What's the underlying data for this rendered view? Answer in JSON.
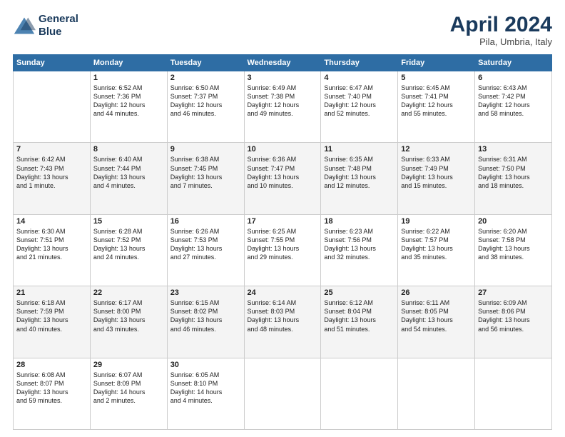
{
  "header": {
    "logo_line1": "General",
    "logo_line2": "Blue",
    "month_year": "April 2024",
    "location": "Pila, Umbria, Italy"
  },
  "weekdays": [
    "Sunday",
    "Monday",
    "Tuesday",
    "Wednesday",
    "Thursday",
    "Friday",
    "Saturday"
  ],
  "weeks": [
    [
      {
        "day": "",
        "text": ""
      },
      {
        "day": "1",
        "text": "Sunrise: 6:52 AM\nSunset: 7:36 PM\nDaylight: 12 hours\nand 44 minutes."
      },
      {
        "day": "2",
        "text": "Sunrise: 6:50 AM\nSunset: 7:37 PM\nDaylight: 12 hours\nand 46 minutes."
      },
      {
        "day": "3",
        "text": "Sunrise: 6:49 AM\nSunset: 7:38 PM\nDaylight: 12 hours\nand 49 minutes."
      },
      {
        "day": "4",
        "text": "Sunrise: 6:47 AM\nSunset: 7:40 PM\nDaylight: 12 hours\nand 52 minutes."
      },
      {
        "day": "5",
        "text": "Sunrise: 6:45 AM\nSunset: 7:41 PM\nDaylight: 12 hours\nand 55 minutes."
      },
      {
        "day": "6",
        "text": "Sunrise: 6:43 AM\nSunset: 7:42 PM\nDaylight: 12 hours\nand 58 minutes."
      }
    ],
    [
      {
        "day": "7",
        "text": "Sunrise: 6:42 AM\nSunset: 7:43 PM\nDaylight: 13 hours\nand 1 minute."
      },
      {
        "day": "8",
        "text": "Sunrise: 6:40 AM\nSunset: 7:44 PM\nDaylight: 13 hours\nand 4 minutes."
      },
      {
        "day": "9",
        "text": "Sunrise: 6:38 AM\nSunset: 7:45 PM\nDaylight: 13 hours\nand 7 minutes."
      },
      {
        "day": "10",
        "text": "Sunrise: 6:36 AM\nSunset: 7:47 PM\nDaylight: 13 hours\nand 10 minutes."
      },
      {
        "day": "11",
        "text": "Sunrise: 6:35 AM\nSunset: 7:48 PM\nDaylight: 13 hours\nand 12 minutes."
      },
      {
        "day": "12",
        "text": "Sunrise: 6:33 AM\nSunset: 7:49 PM\nDaylight: 13 hours\nand 15 minutes."
      },
      {
        "day": "13",
        "text": "Sunrise: 6:31 AM\nSunset: 7:50 PM\nDaylight: 13 hours\nand 18 minutes."
      }
    ],
    [
      {
        "day": "14",
        "text": "Sunrise: 6:30 AM\nSunset: 7:51 PM\nDaylight: 13 hours\nand 21 minutes."
      },
      {
        "day": "15",
        "text": "Sunrise: 6:28 AM\nSunset: 7:52 PM\nDaylight: 13 hours\nand 24 minutes."
      },
      {
        "day": "16",
        "text": "Sunrise: 6:26 AM\nSunset: 7:53 PM\nDaylight: 13 hours\nand 27 minutes."
      },
      {
        "day": "17",
        "text": "Sunrise: 6:25 AM\nSunset: 7:55 PM\nDaylight: 13 hours\nand 29 minutes."
      },
      {
        "day": "18",
        "text": "Sunrise: 6:23 AM\nSunset: 7:56 PM\nDaylight: 13 hours\nand 32 minutes."
      },
      {
        "day": "19",
        "text": "Sunrise: 6:22 AM\nSunset: 7:57 PM\nDaylight: 13 hours\nand 35 minutes."
      },
      {
        "day": "20",
        "text": "Sunrise: 6:20 AM\nSunset: 7:58 PM\nDaylight: 13 hours\nand 38 minutes."
      }
    ],
    [
      {
        "day": "21",
        "text": "Sunrise: 6:18 AM\nSunset: 7:59 PM\nDaylight: 13 hours\nand 40 minutes."
      },
      {
        "day": "22",
        "text": "Sunrise: 6:17 AM\nSunset: 8:00 PM\nDaylight: 13 hours\nand 43 minutes."
      },
      {
        "day": "23",
        "text": "Sunrise: 6:15 AM\nSunset: 8:02 PM\nDaylight: 13 hours\nand 46 minutes."
      },
      {
        "day": "24",
        "text": "Sunrise: 6:14 AM\nSunset: 8:03 PM\nDaylight: 13 hours\nand 48 minutes."
      },
      {
        "day": "25",
        "text": "Sunrise: 6:12 AM\nSunset: 8:04 PM\nDaylight: 13 hours\nand 51 minutes."
      },
      {
        "day": "26",
        "text": "Sunrise: 6:11 AM\nSunset: 8:05 PM\nDaylight: 13 hours\nand 54 minutes."
      },
      {
        "day": "27",
        "text": "Sunrise: 6:09 AM\nSunset: 8:06 PM\nDaylight: 13 hours\nand 56 minutes."
      }
    ],
    [
      {
        "day": "28",
        "text": "Sunrise: 6:08 AM\nSunset: 8:07 PM\nDaylight: 13 hours\nand 59 minutes."
      },
      {
        "day": "29",
        "text": "Sunrise: 6:07 AM\nSunset: 8:09 PM\nDaylight: 14 hours\nand 2 minutes."
      },
      {
        "day": "30",
        "text": "Sunrise: 6:05 AM\nSunset: 8:10 PM\nDaylight: 14 hours\nand 4 minutes."
      },
      {
        "day": "",
        "text": ""
      },
      {
        "day": "",
        "text": ""
      },
      {
        "day": "",
        "text": ""
      },
      {
        "day": "",
        "text": ""
      }
    ]
  ]
}
